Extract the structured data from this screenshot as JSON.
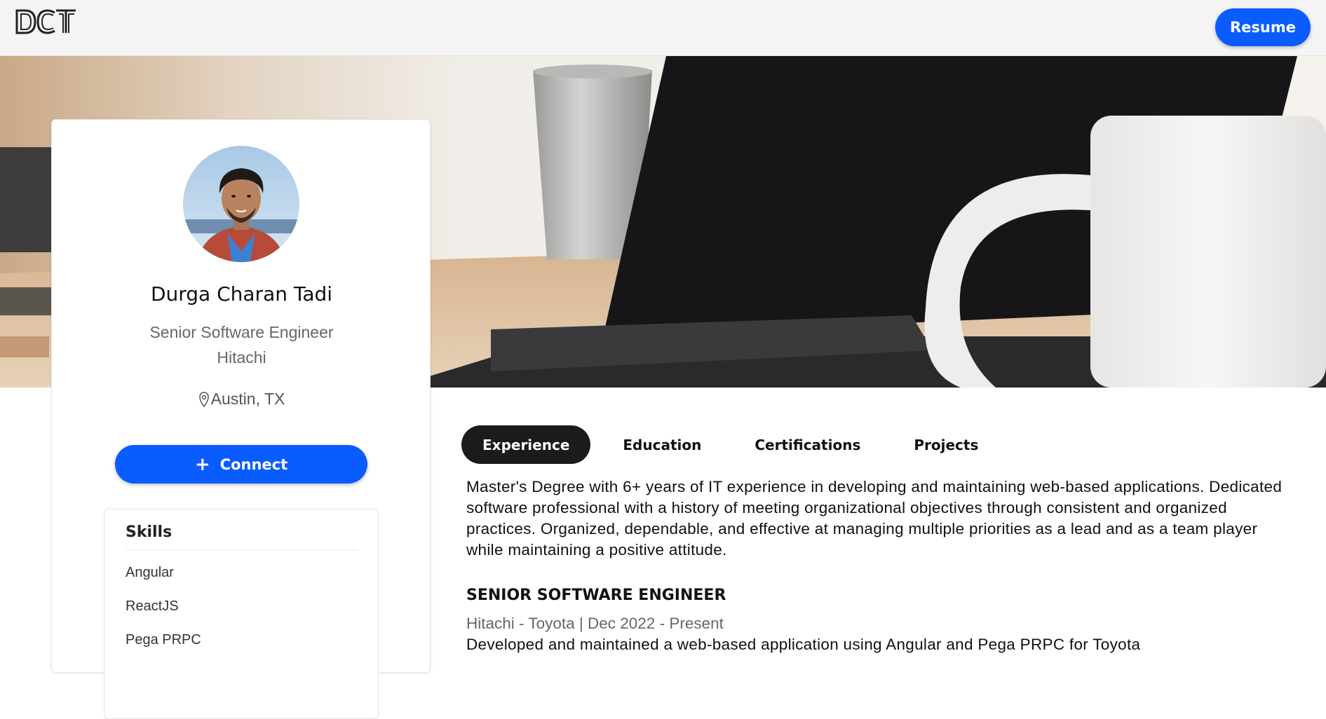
{
  "header": {
    "logo_text": "DCT",
    "resume_label": "Resume"
  },
  "profile": {
    "name": "Durga Charan Tadi",
    "title": "Senior Software Engineer",
    "company": "Hitachi",
    "location": "Austin, TX",
    "connect_label": "Connect",
    "connect_icon": "plus-icon",
    "location_icon": "map-pin-icon"
  },
  "skills": {
    "title": "Skills",
    "items": [
      "Angular",
      "ReactJS",
      "Pega PRPC"
    ]
  },
  "tabs": [
    {
      "label": "Experience",
      "active": true
    },
    {
      "label": "Education",
      "active": false
    },
    {
      "label": "Certifications",
      "active": false
    },
    {
      "label": "Projects",
      "active": false
    }
  ],
  "experience": {
    "summary": "Master's Degree with 6+ years of IT experience in developing and maintaining web-based applications. Dedicated software professional with a history of meeting organizational objectives through consistent and organized practices. Organized, dependable, and effective at managing multiple priorities as a lead and as a team player while maintaining a positive attitude.",
    "jobs": [
      {
        "title": "SENIOR SOFTWARE ENGINEER",
        "meta": "Hitachi - Toyota | Dec 2022 - Present",
        "description": "Developed and maintained a web-based application using Angular and Pega PRPC for Toyota"
      }
    ]
  },
  "colors": {
    "accent": "#0a5cff",
    "active_tab": "#1b1b1b",
    "header_bg": "#f4f4f4"
  }
}
